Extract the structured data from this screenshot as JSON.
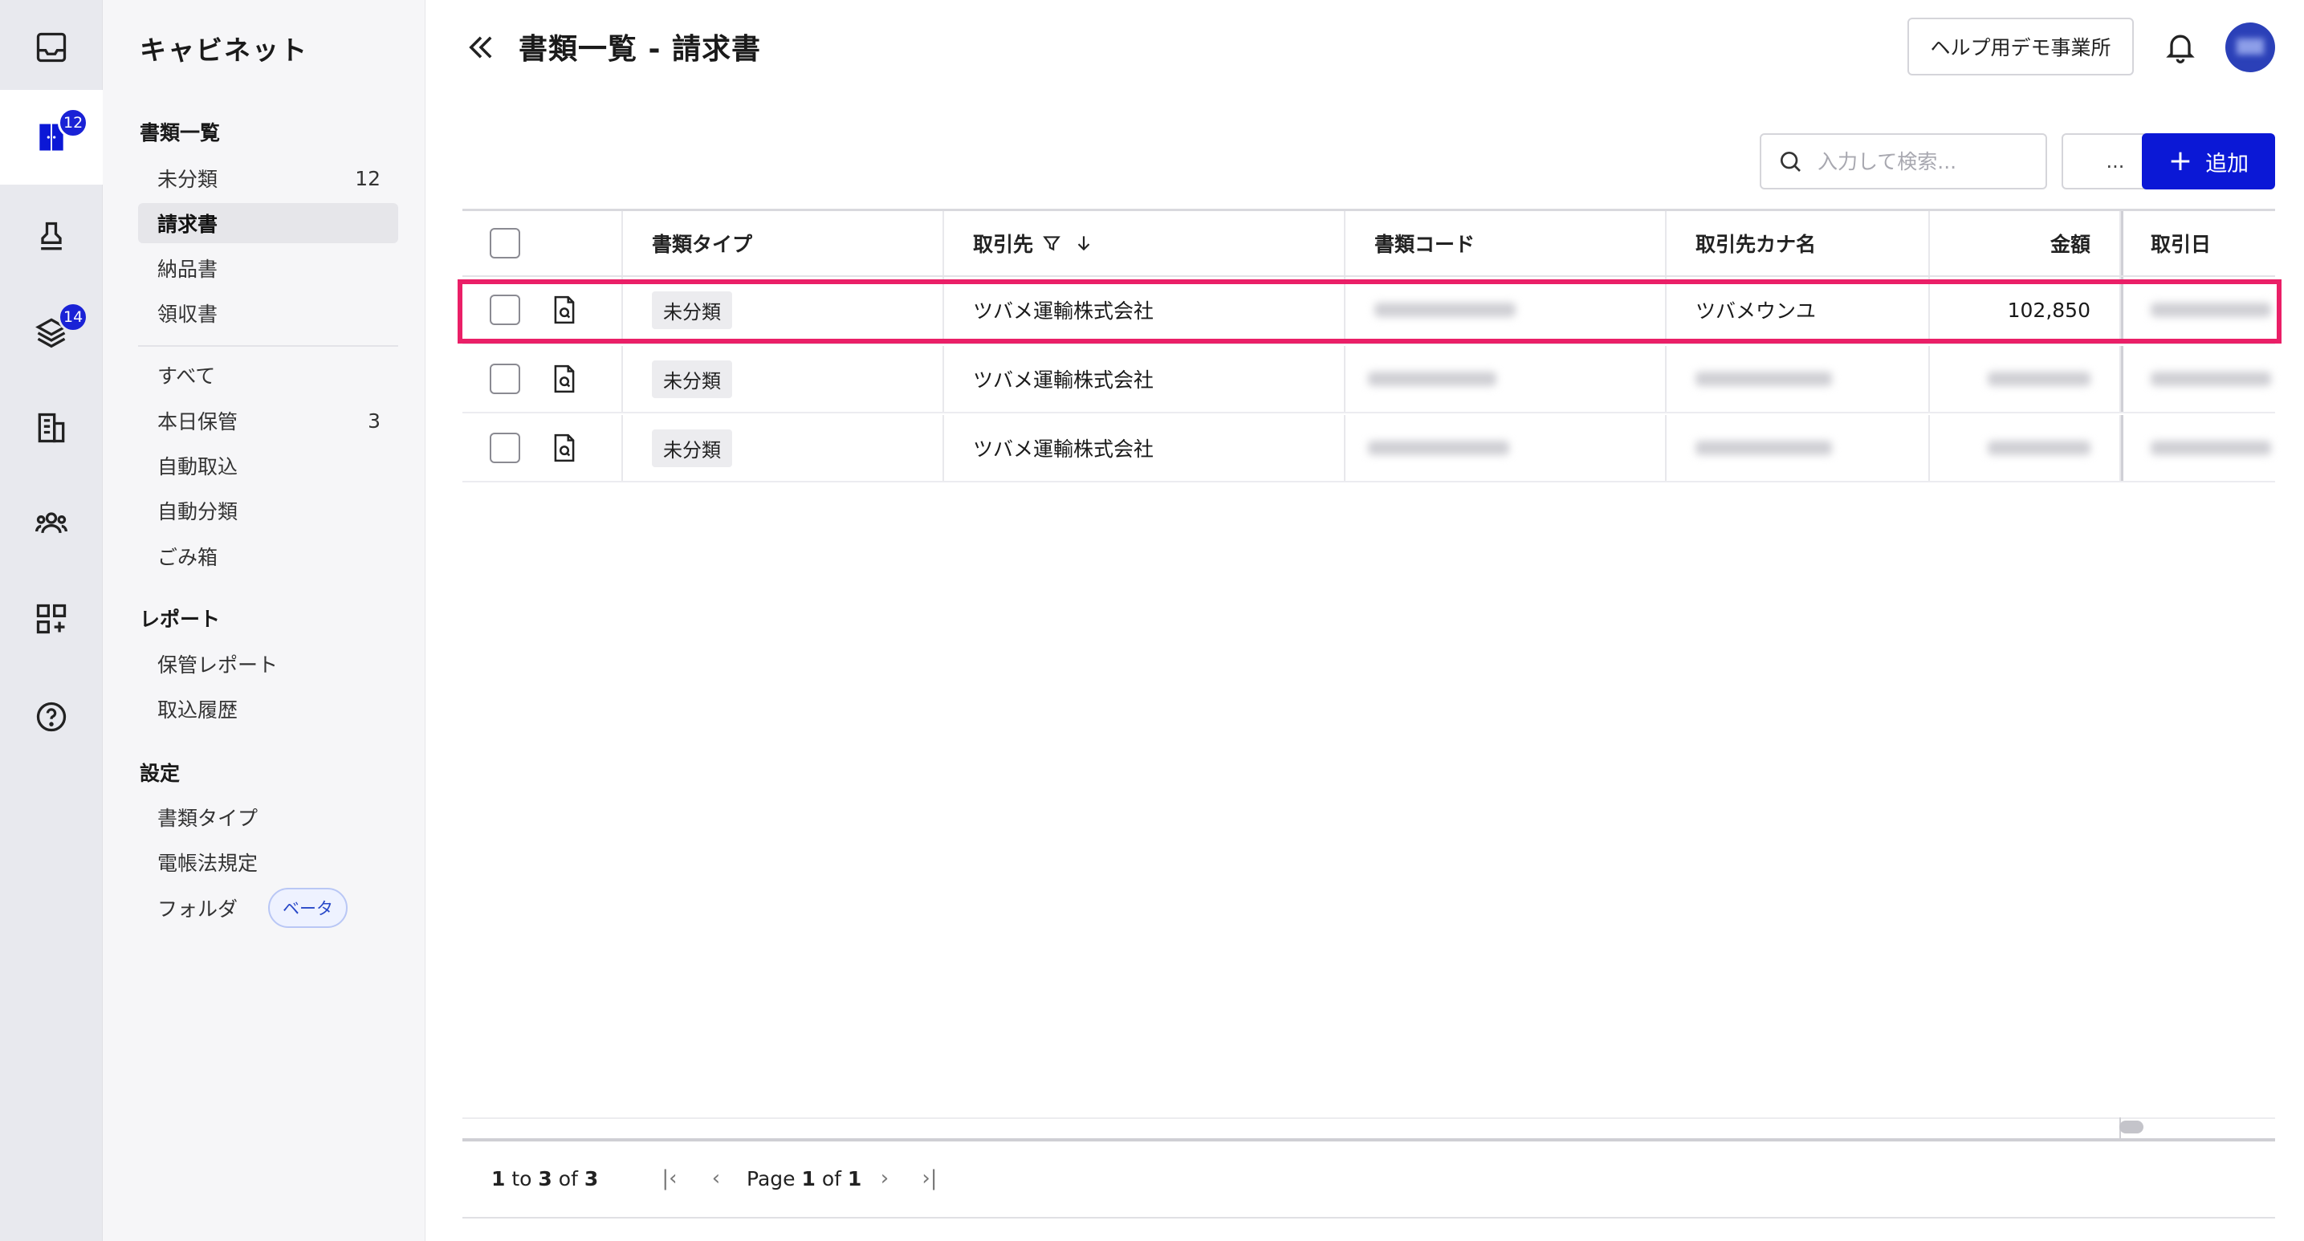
{
  "sidebar": {
    "title": "キャビネット",
    "sections": {
      "documents": "書類一覧",
      "report": "レポート",
      "settings": "設定"
    },
    "items": {
      "unclassified": {
        "label": "未分類",
        "count": "12"
      },
      "invoice": {
        "label": "請求書"
      },
      "delivery": {
        "label": "納品書"
      },
      "receipt": {
        "label": "領収書"
      },
      "all": {
        "label": "すべて"
      },
      "today": {
        "label": "本日保管",
        "count": "3"
      },
      "auto_import": {
        "label": "自動取込"
      },
      "auto_classify": {
        "label": "自動分類"
      },
      "trash": {
        "label": "ごみ箱"
      },
      "storage_report": {
        "label": "保管レポート"
      },
      "import_history": {
        "label": "取込履歴"
      },
      "doc_type": {
        "label": "書類タイプ"
      },
      "eba": {
        "label": "電帳法規定"
      },
      "folder": {
        "label": "フォルダ",
        "badge": "ベータ"
      }
    }
  },
  "rail": {
    "badges": {
      "documents": "12",
      "stack": "14"
    }
  },
  "header": {
    "title": "書類一覧 - 請求書",
    "office": "ヘルプ用デモ事業所"
  },
  "toolbar": {
    "search_placeholder": "入力して検索...",
    "more_label": "...",
    "add_label": "追加"
  },
  "table": {
    "columns": {
      "type": "書類タイプ",
      "partner": "取引先",
      "code": "書類コード",
      "kana": "取引先カナ名",
      "amount": "金額",
      "date": "取引日"
    },
    "rows": [
      {
        "type": "未分類",
        "partner": "ツバメ運輸株式会社",
        "kana": "ツバメウンユ",
        "amount": "102,850"
      },
      {
        "type": "未分類",
        "partner": "ツバメ運輸株式会社",
        "kana": "",
        "amount": ""
      },
      {
        "type": "未分類",
        "partner": "ツバメ運輸株式会社",
        "kana": "",
        "amount": ""
      }
    ]
  },
  "pager": {
    "from": "1",
    "to": "3",
    "total": "3",
    "page": "1",
    "pages": "1",
    "to_word": "to",
    "of_word": "of",
    "page_word": "Page"
  },
  "colors": {
    "accent": "#0b18d6",
    "highlight": "#ea1f67",
    "badge": "#1a22d6"
  }
}
